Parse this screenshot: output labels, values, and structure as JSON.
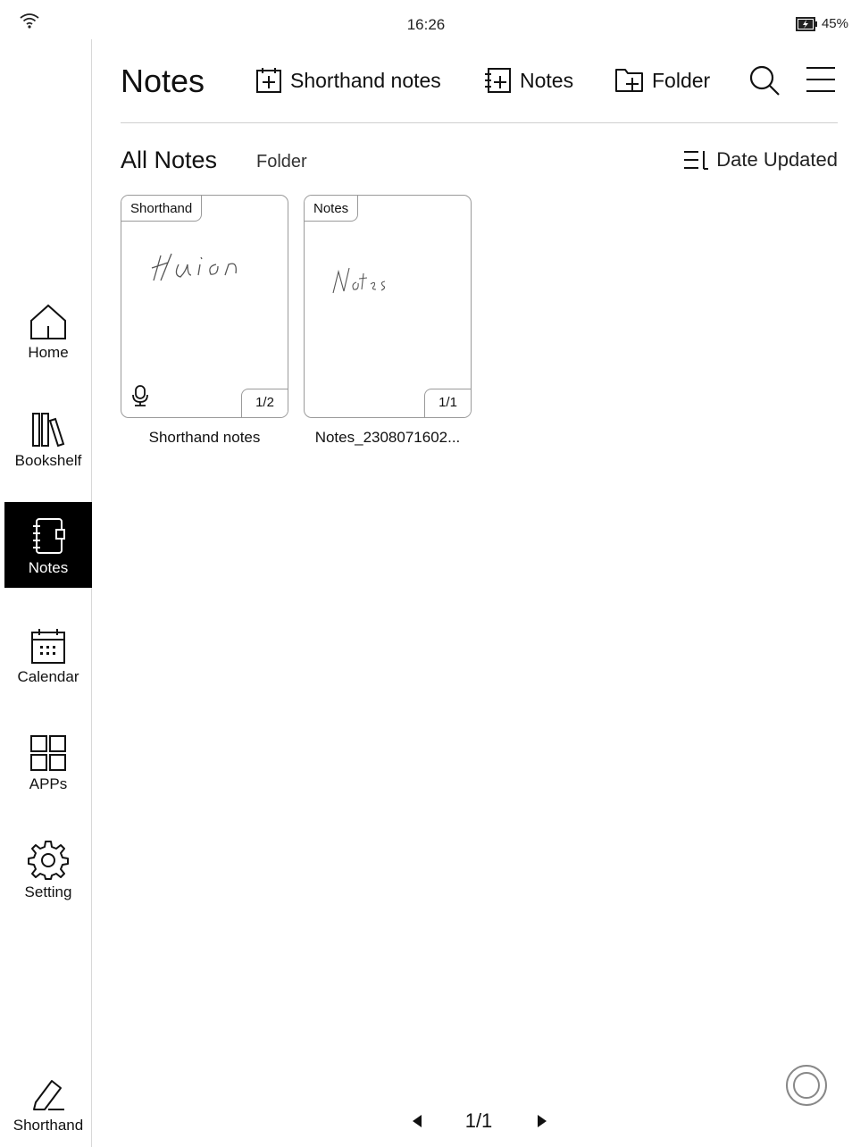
{
  "status": {
    "time": "16:26",
    "battery": "45%"
  },
  "sidebar": {
    "items": [
      {
        "label": "Home",
        "icon": "home-icon"
      },
      {
        "label": "Bookshelf",
        "icon": "bookshelf-icon"
      },
      {
        "label": "Notes",
        "icon": "notebook-icon",
        "active": true
      },
      {
        "label": "Calendar",
        "icon": "calendar-icon"
      },
      {
        "label": "APPs",
        "icon": "apps-grid-icon"
      },
      {
        "label": "Setting",
        "icon": "gear-icon"
      }
    ],
    "shorthand_label": "Shorthand"
  },
  "header": {
    "title": "Notes",
    "shorthand_btn": "Shorthand notes",
    "notes_btn": "Notes",
    "folder_btn": "Folder"
  },
  "filters": {
    "all_notes": "All Notes",
    "folder": "Folder",
    "sort": "Date Updated"
  },
  "notes": [
    {
      "tag": "Shorthand",
      "pages": "1/2",
      "name": "Shorthand notes",
      "handwriting": "Haion",
      "has_audio": true
    },
    {
      "tag": "Notes",
      "pages": "1/1",
      "name": "Notes_2308071602...",
      "handwriting": "Notes",
      "has_audio": false
    }
  ],
  "pager": {
    "current": "1/1"
  }
}
